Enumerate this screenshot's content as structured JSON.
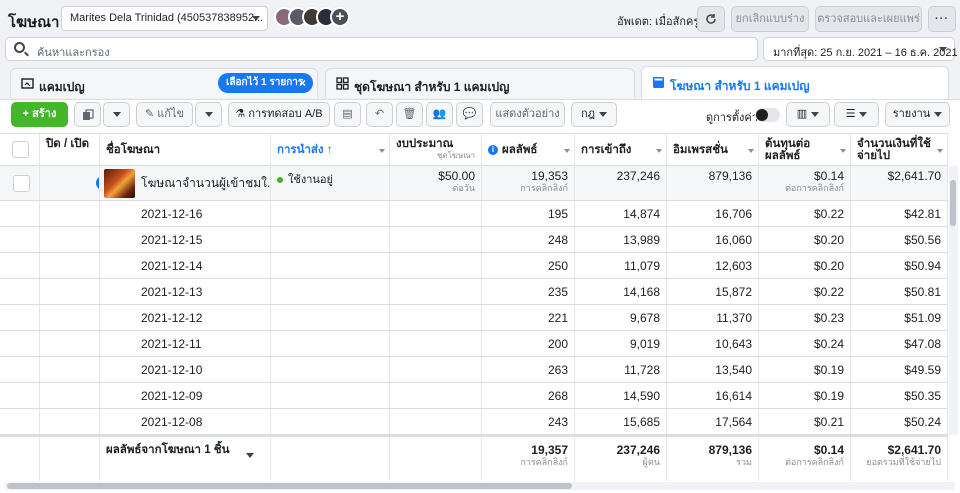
{
  "app": {
    "title": "โฆษณา"
  },
  "account": {
    "name": "Marites Dela Trinidad (450537838952..."
  },
  "header": {
    "updated": "อัพเดต: เมื่อสักครู่",
    "discard_label": "ยกเลิกแบบร่าง",
    "review_label": "ตรวจสอบและเผยแพร่",
    "more_label": "···"
  },
  "search": {
    "placeholder": "ค้นหาและกรอง"
  },
  "date_range": {
    "label": "มากที่สุด: 25 ก.ย. 2021 – 16 ธ.ค. 2021"
  },
  "tabs": {
    "campaigns": "แคมเปญ",
    "selected_pill": "เลือกไว้ 1 รายการ",
    "adsets": "ชุดโฆษณา สำหรับ 1 แคมเปญ",
    "ads": "โฆษณา สำหรับ 1 แคมเปญ"
  },
  "toolbar": {
    "create_label": "+ สร้าง",
    "edit_label": "แก้ไข",
    "abtest_label": "การทดสอบ A/B",
    "preview_label": "แสดงตัวอย่าง",
    "rules_label": "กฎ",
    "setup_label": "ดูการตั้งค่า",
    "report_label": "รายงาน"
  },
  "table": {
    "headers": {
      "onoff": "ปิด / เปิด",
      "name": "ชื่อโฆษณา",
      "delivery": "การนำส่ง ↑",
      "budget": "งบประมาณ",
      "budget_sub": "ชุดโฆษณา",
      "results": "ผลลัพธ์",
      "reach": "การเข้าถึง",
      "impressions": "อิมเพรสชั่น",
      "cpr": "ต้นทุนต่อผลลัพธ์",
      "spent": "จำนวนเงินที่ใช้จ่ายไป"
    },
    "main_row": {
      "name": "โฆษณาจำนวนผู้เข้าชมใ...",
      "delivery": "ใช้งานอยู่",
      "budget": "$50.00",
      "budget_sub": "ต่อวัน",
      "results": "19,353",
      "results_sub": "การคลิกลิงก์",
      "reach": "237,246",
      "impressions": "879,136",
      "cpr": "$0.14",
      "cpr_sub": "ต่อการคลิกลิงก์",
      "spent": "$2,641.70"
    },
    "rows": [
      {
        "date": "2021-12-16",
        "results": "195",
        "reach": "14,874",
        "impressions": "16,706",
        "cpr": "$0.22",
        "spent": "$42.81"
      },
      {
        "date": "2021-12-15",
        "results": "248",
        "reach": "13,989",
        "impressions": "16,060",
        "cpr": "$0.20",
        "spent": "$50.56"
      },
      {
        "date": "2021-12-14",
        "results": "250",
        "reach": "11,079",
        "impressions": "12,603",
        "cpr": "$0.20",
        "spent": "$50.94"
      },
      {
        "date": "2021-12-13",
        "results": "235",
        "reach": "14,168",
        "impressions": "15,872",
        "cpr": "$0.22",
        "spent": "$50.81"
      },
      {
        "date": "2021-12-12",
        "results": "221",
        "reach": "9,678",
        "impressions": "11,370",
        "cpr": "$0.23",
        "spent": "$51.09"
      },
      {
        "date": "2021-12-11",
        "results": "200",
        "reach": "9,019",
        "impressions": "10,643",
        "cpr": "$0.24",
        "spent": "$47.08"
      },
      {
        "date": "2021-12-10",
        "results": "263",
        "reach": "11,728",
        "impressions": "13,540",
        "cpr": "$0.19",
        "spent": "$49.59"
      },
      {
        "date": "2021-12-09",
        "results": "268",
        "reach": "14,590",
        "impressions": "16,614",
        "cpr": "$0.19",
        "spent": "$50.35"
      },
      {
        "date": "2021-12-08",
        "results": "243",
        "reach": "15,685",
        "impressions": "17,564",
        "cpr": "$0.21",
        "spent": "$50.24"
      }
    ],
    "footer": {
      "label": "ผลลัพธ์จากโฆษณา 1 ชิ้น",
      "results": "19,357",
      "results_sub": "การคลิกลิงก์",
      "reach": "237,246",
      "reach_sub": "ผู้คน",
      "impressions": "879,136",
      "impressions_sub": "รวม",
      "cpr": "$0.14",
      "cpr_sub": "ต่อการคลิกลิงก์",
      "spent": "$2,641.70",
      "spent_sub": "ยอดรวมที่ใช้จ่ายไป"
    }
  },
  "colors": {
    "accent": "#1877f2",
    "create": "#42b72a",
    "active": "#42b72a"
  }
}
